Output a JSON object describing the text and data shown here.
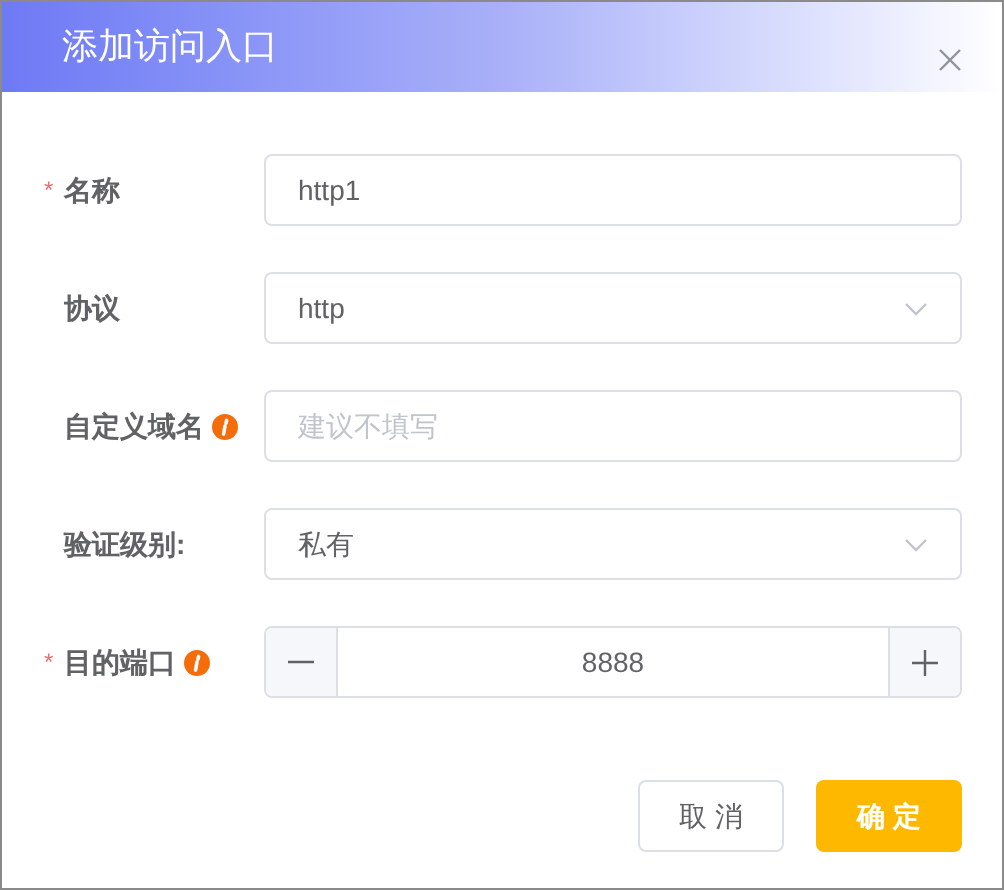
{
  "dialog": {
    "title": "添加访问入口"
  },
  "required_mark": "*",
  "fields": [
    {
      "kind": "text",
      "label": "名称",
      "required": true,
      "info": false,
      "value": "http1"
    },
    {
      "kind": "select",
      "label": "协议",
      "required": false,
      "info": false,
      "value": "http"
    },
    {
      "kind": "text",
      "label": "自定义域名",
      "required": false,
      "info": true,
      "placeholder": "建议不填写"
    },
    {
      "kind": "select",
      "label": "验证级别:",
      "required": false,
      "info": false,
      "value": "私有"
    },
    {
      "kind": "number",
      "label": "目的端口",
      "required": true,
      "info": true,
      "value": "8888"
    }
  ],
  "buttons": [
    {
      "kind": "secondary",
      "label": "取 消"
    },
    {
      "kind": "primary",
      "label": "确 定"
    }
  ]
}
